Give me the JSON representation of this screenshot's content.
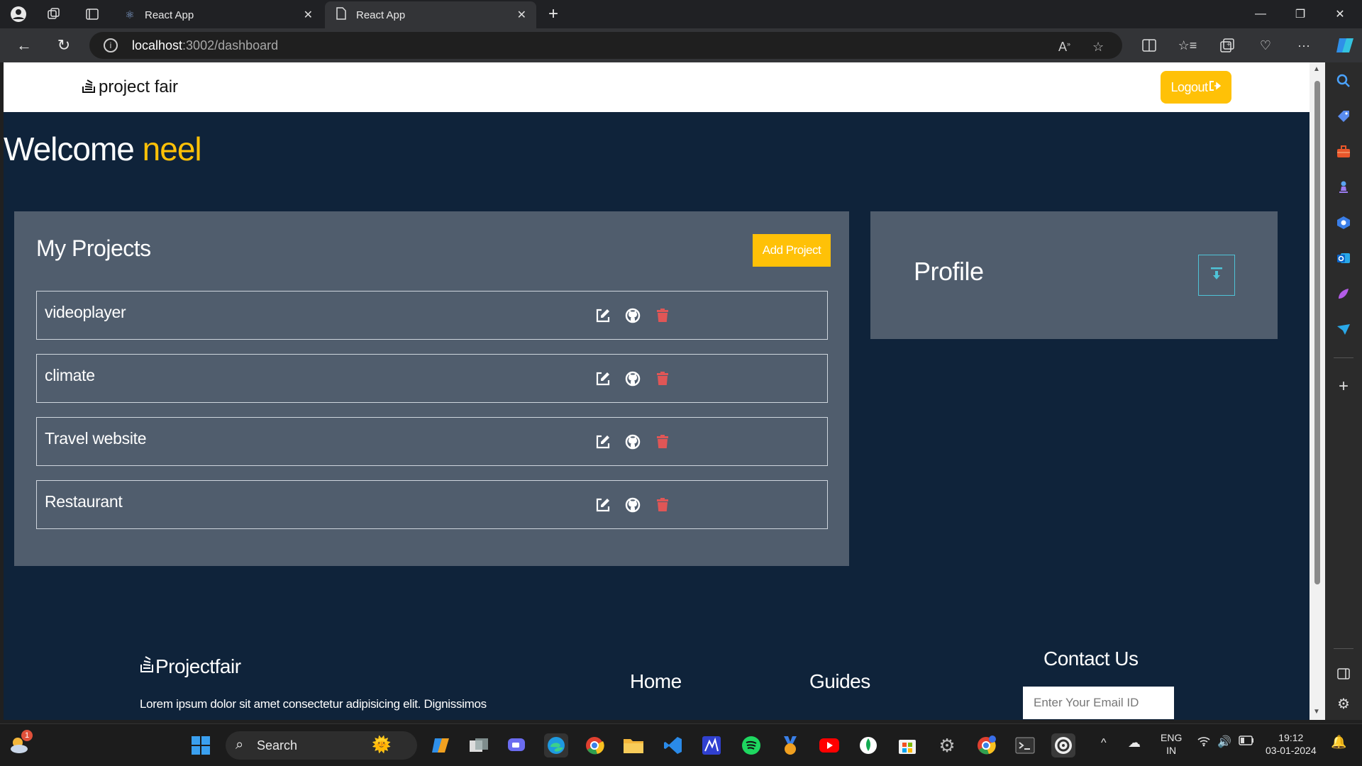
{
  "browser": {
    "tabs": [
      {
        "label": "React App",
        "icon": "react-icon"
      },
      {
        "label": "React App",
        "icon": "page-icon"
      }
    ],
    "url_host": "localhost",
    "url_path": ":3002/dashboard"
  },
  "app": {
    "brand": "project fair",
    "logout_label": "Logout",
    "welcome_prefix": "Welcome",
    "username": "neel",
    "projects_title": "My Projects",
    "add_project_label": "Add Project",
    "projects": [
      {
        "name": "videoplayer"
      },
      {
        "name": "climate"
      },
      {
        "name": "Travel website"
      },
      {
        "name": "Restaurant"
      }
    ],
    "profile_title": "Profile",
    "footer": {
      "brand": "Projectfair",
      "description": "Lorem ipsum dolor sit amet consectetur adipisicing elit. Dignissimos",
      "links": [
        "Home",
        "Guides"
      ],
      "contact_title": "Contact Us",
      "email_placeholder": "Enter Your Email ID"
    }
  },
  "taskbar": {
    "search_label": "Search",
    "lang_top": "ENG",
    "lang_bottom": "IN",
    "time": "19:12",
    "date": "03-01-2024",
    "notification_badge": "1"
  },
  "colors": {
    "accent": "#ffc107",
    "page_bg": "#0f233a",
    "panel_bg": "#505d6d",
    "delete": "#e05656",
    "profile_border": "#4fc3d7"
  }
}
